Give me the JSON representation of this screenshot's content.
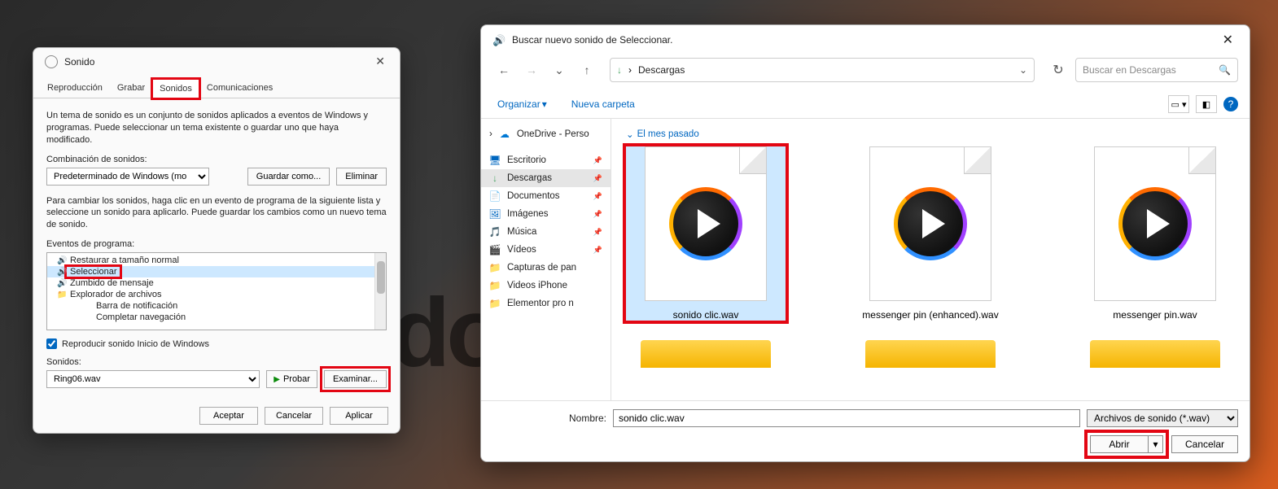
{
  "bg_text": "do",
  "sound": {
    "title": "Sonido",
    "tabs": [
      "Reproducción",
      "Grabar",
      "Sonidos",
      "Comunicaciones"
    ],
    "active_tab": 2,
    "desc": "Un tema de sonido es un conjunto de sonidos aplicados a eventos de Windows y programas. Puede seleccionar un tema existente o guardar uno que haya modificado.",
    "combo_label": "Combinación de sonidos:",
    "scheme": "Predeterminado de Windows (mo",
    "save_as": "Guardar como...",
    "delete": "Eliminar",
    "desc2": "Para cambiar los sonidos, haga clic en un evento de programa de la siguiente lista y seleccione un sonido para aplicarlo. Puede guardar los cambios como un nuevo tema de sonido.",
    "events_label": "Eventos de programa:",
    "events": [
      {
        "label": "Restaurar a tamaño normal",
        "indent": 1,
        "icon": "speaker"
      },
      {
        "label": "Seleccionar",
        "indent": 1,
        "icon": "speaker",
        "selected": true
      },
      {
        "label": "Zumbido de mensaje",
        "indent": 1,
        "icon": "speaker"
      },
      {
        "label": "Explorador de archivos",
        "indent": 0,
        "icon": "folder"
      },
      {
        "label": "Barra de notificación",
        "indent": 2,
        "icon": ""
      },
      {
        "label": "Completar navegación",
        "indent": 2,
        "icon": ""
      }
    ],
    "play_startup": "Reproducir sonido Inicio de Windows",
    "sounds_label": "Sonidos:",
    "selected_sound": "Ring06.wav",
    "test": "Probar",
    "browse": "Examinar...",
    "ok": "Aceptar",
    "cancel": "Cancelar",
    "apply": "Aplicar"
  },
  "file": {
    "title": "Buscar nuevo sonido de Seleccionar.",
    "breadcrumb_icon": "↓",
    "breadcrumb": "Descargas",
    "search_placeholder": "Buscar en Descargas",
    "organize": "Organizar",
    "new_folder": "Nueva carpeta",
    "sidebar": [
      {
        "label": "OneDrive - Perso",
        "icon": "☁",
        "color": "#0078d4",
        "chev": true
      },
      {
        "label": "",
        "spacer": true
      },
      {
        "label": "Escritorio",
        "icon": "🖥",
        "color": "#0067c0",
        "pin": true
      },
      {
        "label": "Descargas",
        "icon": "↓",
        "color": "#4aa564",
        "pin": true,
        "selected": true
      },
      {
        "label": "Documentos",
        "icon": "📄",
        "color": "#5b5b5b",
        "pin": true
      },
      {
        "label": "Imágenes",
        "icon": "🖼",
        "color": "#0067c0",
        "pin": true
      },
      {
        "label": "Música",
        "icon": "🎵",
        "color": "#d83b01",
        "pin": true
      },
      {
        "label": "Vídeos",
        "icon": "🎬",
        "color": "#8661c5",
        "pin": true
      },
      {
        "label": "Capturas de pan",
        "icon": "📁",
        "color": "#f5b400"
      },
      {
        "label": "Videos iPhone",
        "icon": "📁",
        "color": "#f5b400"
      },
      {
        "label": "Elementor pro n",
        "icon": "📁",
        "color": "#f5b400"
      }
    ],
    "group": "El mes pasado",
    "items": [
      {
        "name": "sonido clic.wav",
        "selected": true
      },
      {
        "name": "messenger pin (enhanced).wav"
      },
      {
        "name": "messenger pin.wav"
      }
    ],
    "name_label": "Nombre:",
    "name_value": "sonido clic.wav",
    "filter": "Archivos de sonido (*.wav)",
    "open": "Abrir",
    "cancel": "Cancelar"
  }
}
